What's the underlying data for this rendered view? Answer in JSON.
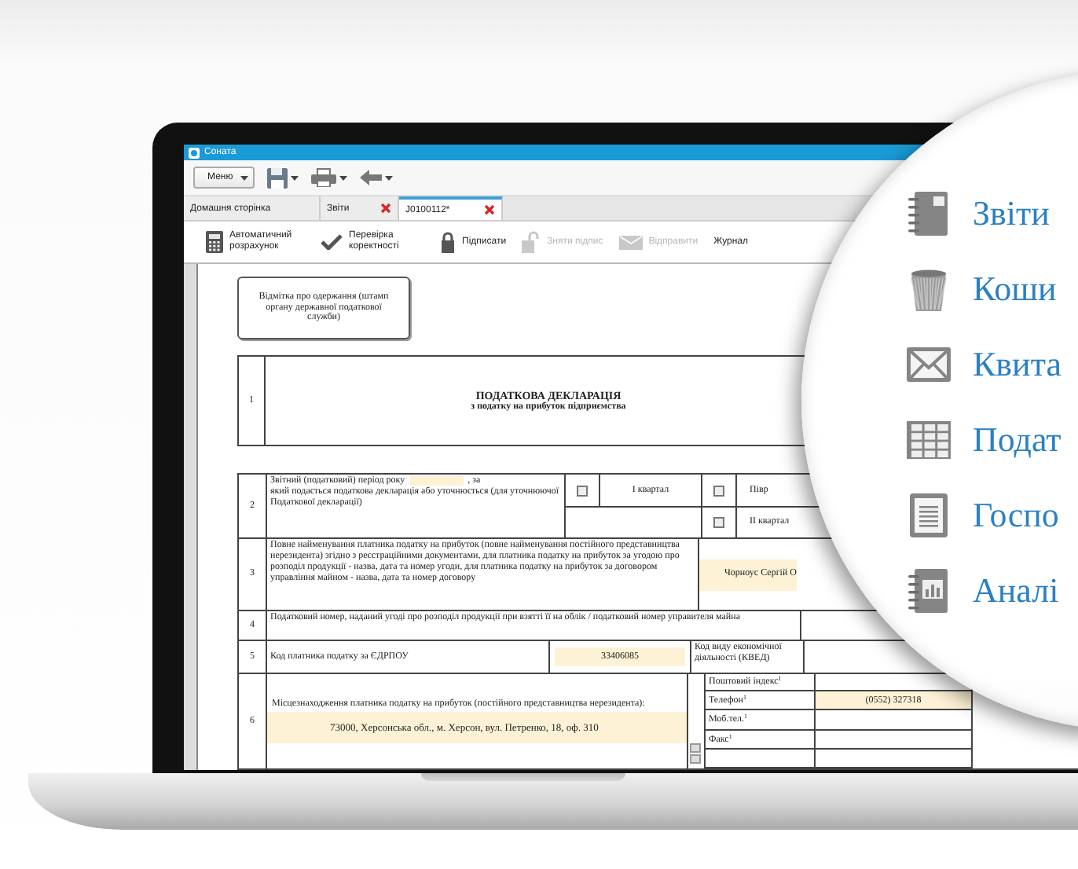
{
  "window": {
    "title": "Соната"
  },
  "toolbar": {
    "menu_label": "Меню"
  },
  "tabs": [
    {
      "label": "Домашня сторінка",
      "selected": false,
      "closable": false
    },
    {
      "label": "Звіти",
      "selected": false,
      "closable": true
    },
    {
      "label": "J0100112*",
      "selected": true,
      "closable": true
    }
  ],
  "actions": [
    {
      "label": "Автоматичний розрахунок",
      "kind": "calculator",
      "disabled": false
    },
    {
      "label": "Перевірка коректності",
      "kind": "check",
      "disabled": false
    },
    {
      "label": "Підписати",
      "kind": "lock",
      "disabled": false
    },
    {
      "label": "Зняти підпис",
      "kind": "unlock",
      "disabled": true
    },
    {
      "label": "Відправити",
      "kind": "envelope",
      "disabled": true
    },
    {
      "label": "Журнал",
      "kind": "text",
      "disabled": false
    }
  ],
  "form": {
    "stamp_note": "Відмітка про одержання (штамп органу державної податкової служби)",
    "title_section": {
      "number": "1",
      "title": "ПОДАТКОВА ДЕКЛАРАЦІЯ",
      "subtitle": "з податку на прибуток підприємства"
    },
    "period_section": {
      "number": "2",
      "text_before": "Звітний (податковий) період року",
      "text_after": ", за",
      "text_continued": "який подається податкова декларація або уточнюється (для уточнюючої Податкової декларації)",
      "options": [
        {
          "label": "I квартал",
          "checked": false
        },
        {
          "label": "Півр",
          "checked": false
        },
        {
          "label": "II квартал",
          "checked": false
        }
      ]
    },
    "name_section": {
      "number": "3",
      "text": "Повне найменування платника податку на прибуток (повне найменування постійного представництва нерезидента) згідно з реєстраційними документами, для платника податку на прибуток за угодою про розподіл продукції - назва, дата та номер угоди, для платника податку на прибуток за договором управління майном - назва, дата та номер договору",
      "value": "Чорноус Сергій О"
    },
    "tax_number_section": {
      "number": "4",
      "text": "Податковий номер, наданий угоді про розподіл продукції при взятті її на облік / податковий номер управителя майна"
    },
    "edrpou_section": {
      "number": "5",
      "text": "Код платника податку за ЄДРПОУ",
      "value": "33406085",
      "kved_label": "Код виду економічної діяльності (КВЕД)"
    },
    "address_section": {
      "number": "6",
      "text": "Місцезнаходження платника податку на прибуток (постійного представництва нерезидента):",
      "value": "73000, Херсонська обл., м. Херсон, вул. Петренко, 18, оф. 310",
      "contacts": [
        {
          "label": "Поштовий індекс$^{1}$"
        },
        {
          "label": "Телефон$^{1}$",
          "value": "(0552) 327318"
        },
        {
          "label": "Моб.тел.$^{1}$"
        },
        {
          "label": "Факс$^{1}$"
        }
      ]
    }
  },
  "magnifier": {
    "items": [
      {
        "label": "Звіти",
        "kind": "notebook"
      },
      {
        "label": "Коши",
        "kind": "trash"
      },
      {
        "label": "Квита",
        "kind": "envelope"
      },
      {
        "label": "Подат",
        "kind": "grid"
      },
      {
        "label": "Госпо",
        "kind": "document"
      },
      {
        "label": "Аналі",
        "kind": "chart-notebook"
      }
    ]
  }
}
